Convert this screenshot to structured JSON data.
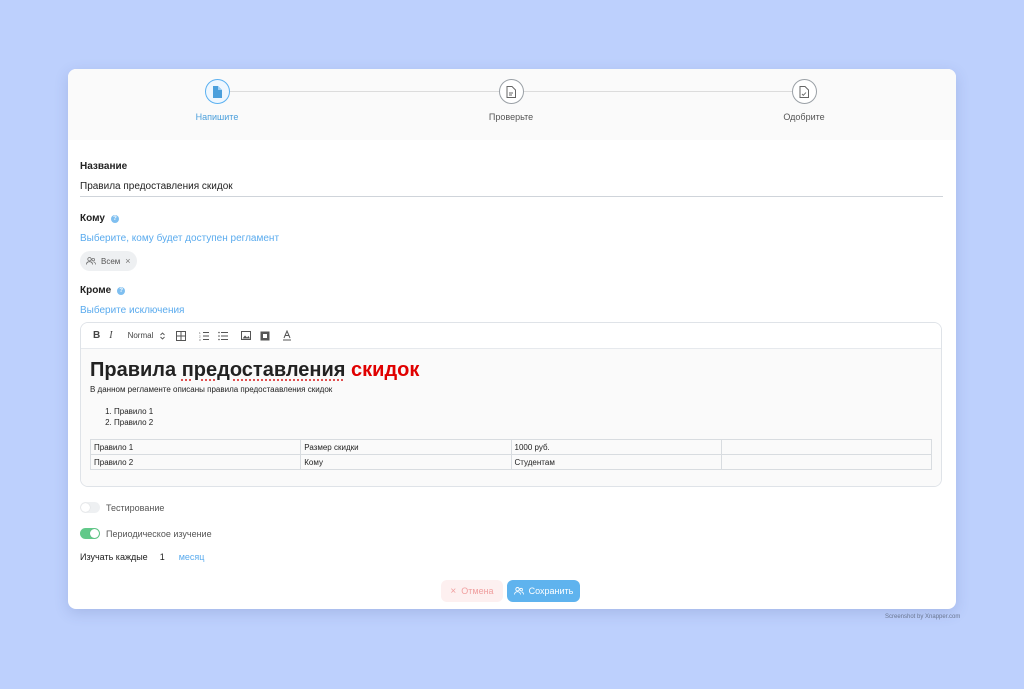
{
  "stepper": {
    "steps": [
      {
        "label": "Напишите",
        "active": true,
        "icon": "document-icon"
      },
      {
        "label": "Проверьте",
        "active": false,
        "icon": "document-lines-icon"
      },
      {
        "label": "Одобрите",
        "active": false,
        "icon": "document-check-icon"
      }
    ]
  },
  "form": {
    "name_label": "Название",
    "name_value": "Правила предоставления скидок",
    "to_label": "Кому",
    "to_placeholder": "Выберите, кому будет доступен регламент",
    "chip_label": "Всем",
    "except_label": "Кроме",
    "except_placeholder": "Выберите исключения"
  },
  "editor": {
    "toolbar": {
      "bold": "B",
      "italic": "I",
      "format": "Normal"
    },
    "doc": {
      "title_main": "Правила предоставления",
      "title_red": "скидок",
      "description": "В данном регламенте описаны правила предостаавления скидок",
      "list": [
        "Правило 1",
        "Правило 2"
      ],
      "table": [
        [
          "Правило 1",
          "Размер скидки",
          "1000 руб.",
          ""
        ],
        [
          "Правило 2",
          "Кому",
          "Студентам",
          ""
        ]
      ]
    }
  },
  "options": {
    "testing_label": "Тестирование",
    "testing_on": false,
    "periodic_label": "Периодическое изучение",
    "periodic_on": true,
    "study_every_label": "Изучать каждые",
    "study_every_value": "1",
    "study_every_unit": "месяц"
  },
  "actions": {
    "cancel_label": "Отмена",
    "save_label": "Сохранить"
  },
  "colors": {
    "background": "#bdd0fd",
    "accent": "#5fb3ee",
    "link": "#5aabee",
    "toggle_on": "#62c98a",
    "title_red": "#e00000"
  },
  "watermark": "Screenshot by Xnapper.com"
}
